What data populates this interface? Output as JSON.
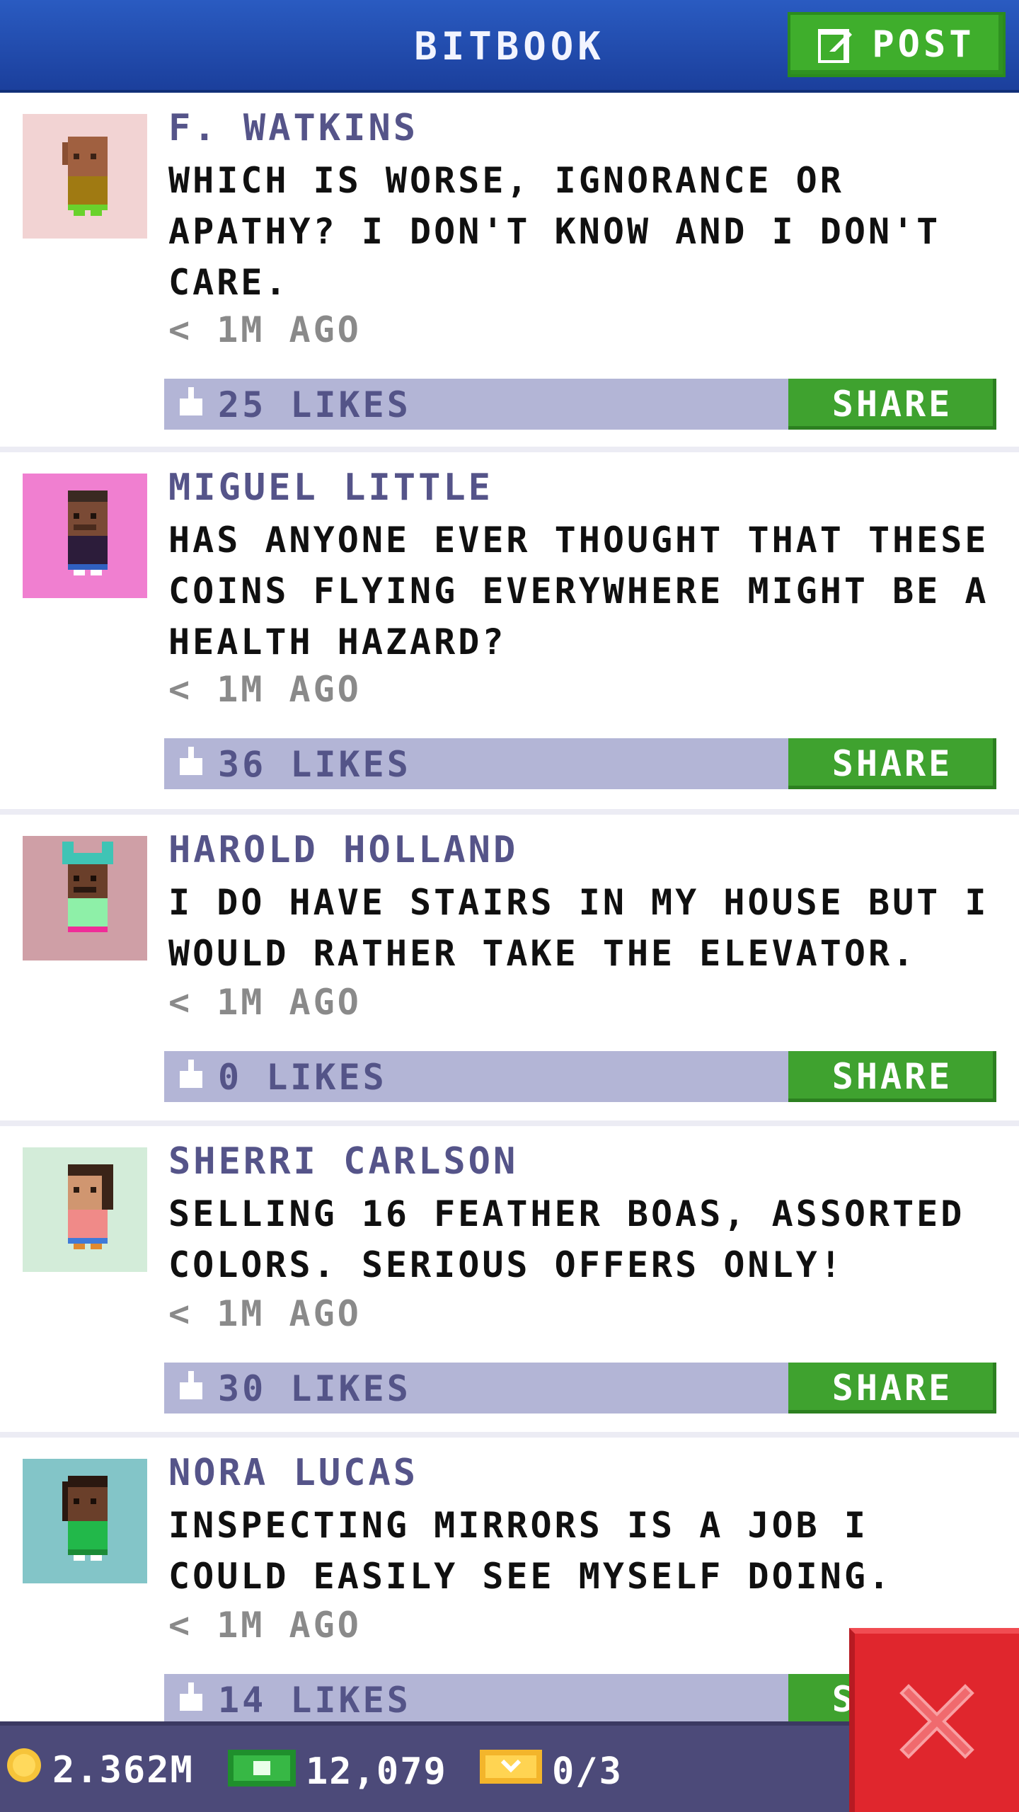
{
  "header": {
    "title": "BITBOOK",
    "post_label": "POST"
  },
  "posts": [
    {
      "author": "F. WATKINS",
      "message": "WHICH IS WORSE, IGNORANCE OR APATHY? I DON'T KNOW AND I DON'T CARE.",
      "time": "< 1M AGO",
      "likes": "25 LIKES",
      "share": "SHARE",
      "avatar_bg": "#f2d3d3"
    },
    {
      "author": "MIGUEL LITTLE",
      "message": "HAS ANYONE EVER THOUGHT THAT THESE COINS FLYING EVERYWHERE MIGHT BE A HEALTH HAZARD?",
      "time": "< 1M AGO",
      "likes": "36 LIKES",
      "share": "SHARE",
      "avatar_bg": "#f07fd0"
    },
    {
      "author": "HAROLD HOLLAND",
      "message": "I DO HAVE STAIRS IN MY HOUSE BUT I WOULD RATHER TAKE THE ELEVATOR.",
      "time": "< 1M AGO",
      "likes": "0 LIKES",
      "share": "SHARE",
      "avatar_bg": "#cf9fa6"
    },
    {
      "author": "SHERRI CARLSON",
      "message": "SELLING 16 FEATHER BOAS, ASSORTED COLORS. SERIOUS OFFERS ONLY!",
      "time": "< 1M AGO",
      "likes": "30 LIKES",
      "share": "SHARE",
      "avatar_bg": "#d3ecd9"
    },
    {
      "author": "NORA LUCAS",
      "message": "INSPECTING MIRRORS IS A JOB I COULD EASILY SEE MYSELF DOING.",
      "time": "< 1M AGO",
      "likes": "14 LIKES",
      "share": "SHARE",
      "avatar_bg": "#83c5c8"
    }
  ],
  "status_bar": {
    "coins": "2.362M",
    "bux": "12,079",
    "tickets": "0/3"
  },
  "colors": {
    "header_blue": "#2a5bc1",
    "post_green": "#3fae2c",
    "like_bar": "#b3b5d6",
    "close_red": "#e0262d"
  }
}
